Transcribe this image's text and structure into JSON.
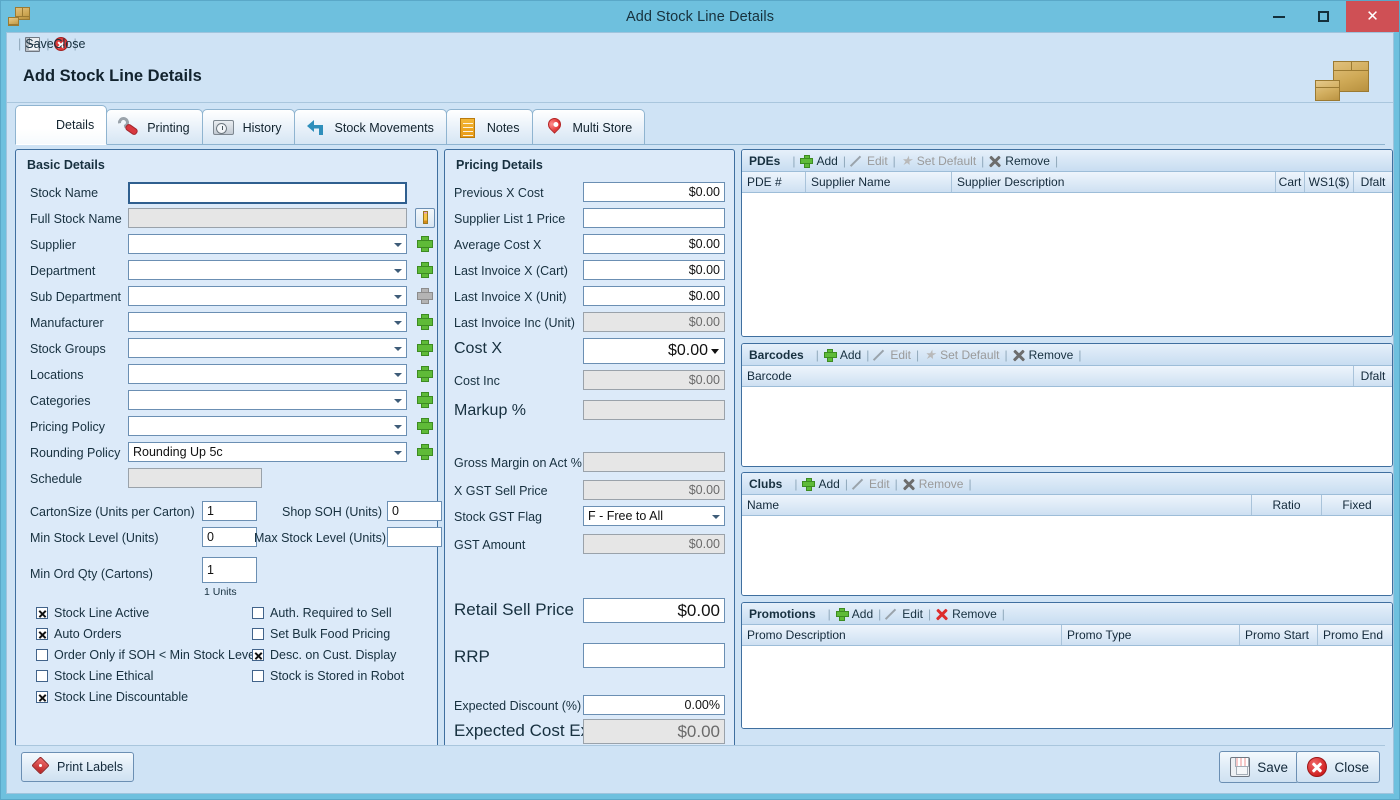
{
  "window": {
    "title": "Add Stock Line Details",
    "icon": "carton-icon",
    "controls": {
      "minimize": "–",
      "maximize": "□",
      "close": "✕"
    }
  },
  "toolbar": {
    "save_label": "Save",
    "close_label": "Close"
  },
  "header": {
    "title": "Add Stock Line Details"
  },
  "tabs": [
    {
      "label": "Details",
      "icon": "carton-icon",
      "active": true
    },
    {
      "label": "Printing",
      "icon": "wrench-screwdriver-icon",
      "active": false
    },
    {
      "label": "History",
      "icon": "folder-clock-icon",
      "active": false
    },
    {
      "label": "Stock Movements",
      "icon": "back-arrow-icon",
      "active": false
    },
    {
      "label": "Notes",
      "icon": "note-icon",
      "active": false
    },
    {
      "label": "Multi Store",
      "icon": "map-pin-icon",
      "active": false
    }
  ],
  "basic_details": {
    "title": "Basic Details",
    "fields": [
      {
        "label": "Stock Name",
        "value": "",
        "type": "text",
        "focused": true
      },
      {
        "label": "Full Stock Name",
        "value": "",
        "type": "text",
        "readonly": true,
        "action": "pencil-icon"
      },
      {
        "label": "Supplier",
        "value": "",
        "type": "combo",
        "action": "plus-icon"
      },
      {
        "label": "Department",
        "value": "",
        "type": "combo",
        "action": "plus-icon"
      },
      {
        "label": "Sub Department",
        "value": "",
        "type": "combo",
        "action": "plus-icon-disabled"
      },
      {
        "label": "Manufacturer",
        "value": "",
        "type": "combo",
        "action": "plus-icon"
      },
      {
        "label": "Stock Groups",
        "value": "",
        "type": "combo",
        "action": "plus-icon"
      },
      {
        "label": "Locations",
        "value": "",
        "type": "combo",
        "action": "plus-icon"
      },
      {
        "label": "Categories",
        "value": "",
        "type": "combo",
        "action": "plus-icon"
      },
      {
        "label": "Pricing Policy",
        "value": "",
        "type": "combo",
        "action": "plus-icon"
      },
      {
        "label": "Rounding Policy",
        "value": "Rounding Up 5c",
        "type": "combo",
        "action": "plus-icon"
      },
      {
        "label": "Schedule",
        "value": "",
        "type": "text",
        "readonly": true
      }
    ],
    "numeric": {
      "carton_size_label": "CartonSize (Units per Carton)",
      "carton_size_value": "1",
      "shop_soh_label": "Shop SOH (Units)",
      "shop_soh_value": "0",
      "min_stock_label": "Min Stock Level (Units)",
      "min_stock_value": "0",
      "max_stock_label": "Max Stock Level (Units)",
      "max_stock_value": "",
      "min_ord_label": "Min Ord Qty (Cartons)",
      "min_ord_value": "1",
      "min_ord_hint": "1 Units"
    },
    "checkboxes_left": [
      {
        "label": "Stock Line Active",
        "checked": true
      },
      {
        "label": "Auto Orders",
        "checked": true
      },
      {
        "label": "Order Only if SOH < Min Stock Level",
        "checked": false
      },
      {
        "label": "Stock Line Ethical",
        "checked": false
      },
      {
        "label": "Stock Line Discountable",
        "checked": true
      }
    ],
    "checkboxes_right": [
      {
        "label": "Auth. Required to Sell",
        "checked": false
      },
      {
        "label": "Set Bulk Food Pricing",
        "checked": false
      },
      {
        "label": "Desc. on Cust. Display",
        "checked": true
      },
      {
        "label": "Stock is Stored in Robot",
        "checked": false
      }
    ]
  },
  "pricing_details": {
    "title": "Pricing Details",
    "fields": [
      {
        "label": "Previous X Cost",
        "value": "$0.00",
        "readonly": false,
        "size": "normal"
      },
      {
        "label": "Supplier List 1 Price",
        "value": "",
        "readonly": false,
        "size": "normal"
      },
      {
        "label": "Average Cost X",
        "value": "$0.00",
        "readonly": false,
        "size": "normal"
      },
      {
        "label": "Last Invoice X (Cart)",
        "value": "$0.00",
        "readonly": false,
        "size": "normal"
      },
      {
        "label": "Last Invoice X (Unit)",
        "value": "$0.00",
        "readonly": false,
        "size": "normal"
      },
      {
        "label": "Last Invoice Inc (Unit)",
        "value": "$0.00",
        "readonly": true,
        "size": "normal"
      },
      {
        "label": "Cost X",
        "value": "$0.00",
        "readonly": false,
        "size": "big",
        "dropdown": true
      },
      {
        "label": "Cost Inc",
        "value": "$0.00",
        "readonly": true,
        "size": "normal"
      },
      {
        "label": "Markup %",
        "value": "",
        "readonly": true,
        "size": "big"
      },
      {
        "label": "Gross Margin on Act %",
        "value": "",
        "readonly": true,
        "size": "normal"
      },
      {
        "label": "X GST Sell Price",
        "value": "$0.00",
        "readonly": true,
        "size": "normal"
      },
      {
        "label": "Stock GST Flag",
        "value": "F - Free to All",
        "readonly": false,
        "size": "normal",
        "combo": true
      },
      {
        "label": "GST Amount",
        "value": "$0.00",
        "readonly": true,
        "size": "normal"
      },
      {
        "label": "Retail Sell Price",
        "value": "$0.00",
        "readonly": false,
        "size": "big"
      },
      {
        "label": "RRP",
        "value": "",
        "readonly": false,
        "size": "big"
      },
      {
        "label": "Expected Discount (%)",
        "value": "0.00%",
        "readonly": false,
        "size": "normal"
      },
      {
        "label": "Expected Cost Ex",
        "value": "$0.00",
        "readonly": true,
        "size": "big"
      }
    ]
  },
  "panels": {
    "pdes": {
      "title": "PDEs",
      "actions": [
        {
          "label": "Add",
          "icon": "plus-icon",
          "enabled": true
        },
        {
          "label": "Edit",
          "icon": "pencil-icon",
          "enabled": false
        },
        {
          "label": "Set Default",
          "icon": "star-icon",
          "enabled": false
        },
        {
          "label": "Remove",
          "icon": "x-icon",
          "enabled": true
        }
      ],
      "columns": [
        "PDE #",
        "Supplier Name",
        "Supplier Description",
        "Cart",
        "WS1($)",
        "Dfalt"
      ],
      "rows": []
    },
    "barcodes": {
      "title": "Barcodes",
      "actions": [
        {
          "label": "Add",
          "icon": "plus-icon",
          "enabled": true
        },
        {
          "label": "Edit",
          "icon": "pencil-icon",
          "enabled": false
        },
        {
          "label": "Set Default",
          "icon": "star-icon",
          "enabled": false
        },
        {
          "label": "Remove",
          "icon": "x-icon",
          "enabled": true
        }
      ],
      "columns": [
        "Barcode",
        "Dfalt"
      ],
      "rows": []
    },
    "clubs": {
      "title": "Clubs",
      "actions": [
        {
          "label": "Add",
          "icon": "plus-icon",
          "enabled": true
        },
        {
          "label": "Edit",
          "icon": "pencil-icon",
          "enabled": false
        },
        {
          "label": "Remove",
          "icon": "x-icon",
          "enabled": false
        }
      ],
      "columns": [
        "Name",
        "Ratio",
        "Fixed"
      ],
      "rows": []
    },
    "promotions": {
      "title": "Promotions",
      "actions": [
        {
          "label": "Add",
          "icon": "plus-icon",
          "enabled": true
        },
        {
          "label": "Edit",
          "icon": "pencil-icon",
          "enabled": true
        },
        {
          "label": "Remove",
          "icon": "x-icon-red",
          "enabled": true
        }
      ],
      "columns": [
        "Promo Description",
        "Promo Type",
        "Promo Start",
        "Promo End"
      ],
      "rows": []
    }
  },
  "footer": {
    "print_labels": "Print Labels",
    "save": "Save",
    "close": "Close"
  },
  "colors": {
    "title_bar": "#6ec0de",
    "client_bg": "#cfe3f5",
    "group_bg": "#dceaf9",
    "group_border": "#3f6f9f",
    "close_button": "#cf5055",
    "accent_green": "#5fbb38",
    "accent_red": "#dd2c2c"
  }
}
